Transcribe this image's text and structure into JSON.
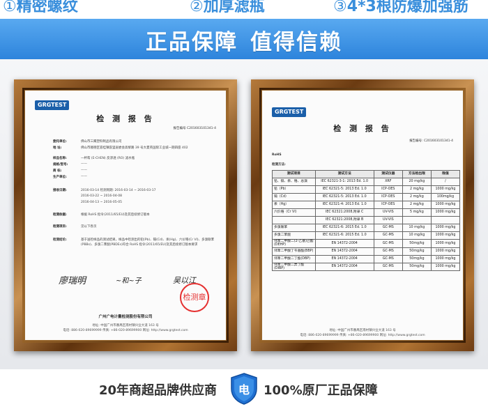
{
  "features": [
    {
      "num": "①",
      "label": "精密螺纹"
    },
    {
      "num": "②",
      "label": "加厚滤瓶"
    },
    {
      "num": "③",
      "label": "4*3根防爆加强筋"
    }
  ],
  "banner": {
    "left": "正品保障",
    "right": "值得信赖"
  },
  "left_report": {
    "logo": "GRGTEST",
    "title": "检 测 报 告",
    "report_no": "报告编号 C201603101341-4",
    "rows": [
      {
        "k": "委托单位:",
        "v": "佛山市三鹰塑料制品有限公司"
      },
      {
        "k": "地    址:",
        "v": "佛山市顺德区容桂镇容里居委会高黎路 39 号大夏英国际工业城一期四座 402"
      },
      {
        "k": "",
        "v": ""
      },
      {
        "k": "样品名称:",
        "v": "一杯帮 (E-CHEN) 反渗透 (RO) 滤水瓶"
      },
      {
        "k": "规格/型号:",
        "v": "——"
      },
      {
        "k": "商    标:",
        "v": "——"
      },
      {
        "k": "生产单位:",
        "v": "——"
      },
      {
        "k": "",
        "v": ""
      },
      {
        "k": "接收日期:",
        "v": "2016-03-14      检测周期: 2016-03-14 ~ 2016-03-17"
      },
      {
        "k": "",
        "v": "                                     2016-03-22 ~ 2016-04-08"
      },
      {
        "k": "",
        "v": "                                     2016-04-13 ~ 2016-05-05"
      },
      {
        "k": "检测依据:",
        "v": "根据 RoHS 指令(2011/65/EU)及其后续修订版本"
      },
      {
        "k": "检测项目:",
        "v": "见以下各页"
      },
      {
        "k": "检测结论:",
        "v": "基于送检样品的测试结果，样品中检测出的铅(Pb)、镉(Cd)、汞(Hg)、六价铬(Cr VI)、多溴联苯(PBBs)、多溴二苯醚(PBDEs)符合 RoHS 指令(2011/65/EU)及其后续修订版本要求"
      }
    ],
    "sig1": "廖瑞明",
    "sig2": "~和~子",
    "sig3": "吴以江",
    "stamp": "检测章",
    "company": "广州广电计量检测股份有限公司",
    "address": "地址: 中国广州市番禺区南村镇兴业大道 163 号",
    "contact": "电话: 886-020-89699999    传真: +86-020-89699900    网址: http://www.grgtest.com"
  },
  "right_report": {
    "logo": "GRGTEST",
    "title": "检 测 报 告",
    "report_no": "报告编号: C201603101341-4",
    "section": "RoHS",
    "section2": "检测方法:",
    "headers": [
      "测试项目",
      "测试方法",
      "测试仪器",
      "方法检出限",
      "限值"
    ],
    "rows": [
      [
        "铅、镉、汞、铬、总溴",
        "IEC 62321-3-1: 2013 Ed. 1.0",
        "XRF",
        "20 mg/kg",
        "/"
      ],
      [
        "铅（Pb）",
        "IEC 62321-5: 2013 Ed. 1.0",
        "ICP-OES",
        "2 mg/kg",
        "1000 mg/kg"
      ],
      [
        "镉（Cd）",
        "IEC 62321-5: 2013 Ed. 1.0",
        "ICP-OES",
        "2 mg/kg",
        "100mg/kg"
      ],
      [
        "汞（Hg）",
        "IEC 62321-4: 2013 Ed. 1.0",
        "ICP-OES",
        "2 mg/kg",
        "1000 mg/kg"
      ],
      [
        "六价铬（Cr VI）",
        "IEC 62321:2008,附录 C",
        "UV-VIS",
        "5 mg/kg",
        "1000 mg/kg"
      ],
      [
        "",
        "IEC 62321:2008,附录 B",
        "UV-VIS",
        "",
        ""
      ],
      [
        "多溴联苯",
        "IEC 62321-6: 2015 Ed. 1.0",
        "GC-MS",
        "10 mg/kg",
        "1000 mg/kg"
      ],
      [
        "多溴二苯醚",
        "IEC 62321-6: 2015 Ed. 1.0",
        "GC-MS",
        "10 mg/kg",
        "1000 mg/kg"
      ],
      [
        "邻苯二甲酸二(2-乙基)己酯(DEHP)",
        "EN 14372-2004",
        "GC-MS",
        "50mg/kg",
        "1000 mg/kg"
      ],
      [
        "邻苯二甲酸丁苄基酯(BBP)",
        "EN 14372-2004",
        "GC-MS",
        "50mg/kg",
        "1000 mg/kg"
      ],
      [
        "邻苯二甲酸二丁酯(DBP)",
        "EN 14372-2004",
        "GC-MS",
        "50mg/kg",
        "1000 mg/kg"
      ],
      [
        "邻苯二甲酸二异丁酯(DIBP)",
        "EN 14372-2004",
        "GC-MS",
        "50mg/kg",
        "1000 mg/kg"
      ]
    ],
    "footer_addr": "地址: 中国广州市番禺区南村镇兴业大道 163 号",
    "footer_contact": "电话: 886-020-89699999    传真: +86-020-89699900    网址: http://www.grgtest.com"
  },
  "bottom": {
    "left": "20年商超品牌供应商",
    "badge": "电",
    "right": "100%原厂正品保障"
  },
  "colors": {
    "banner": "#3a8fdc",
    "frame": "#8b5a24",
    "stamp": "#e53030"
  }
}
